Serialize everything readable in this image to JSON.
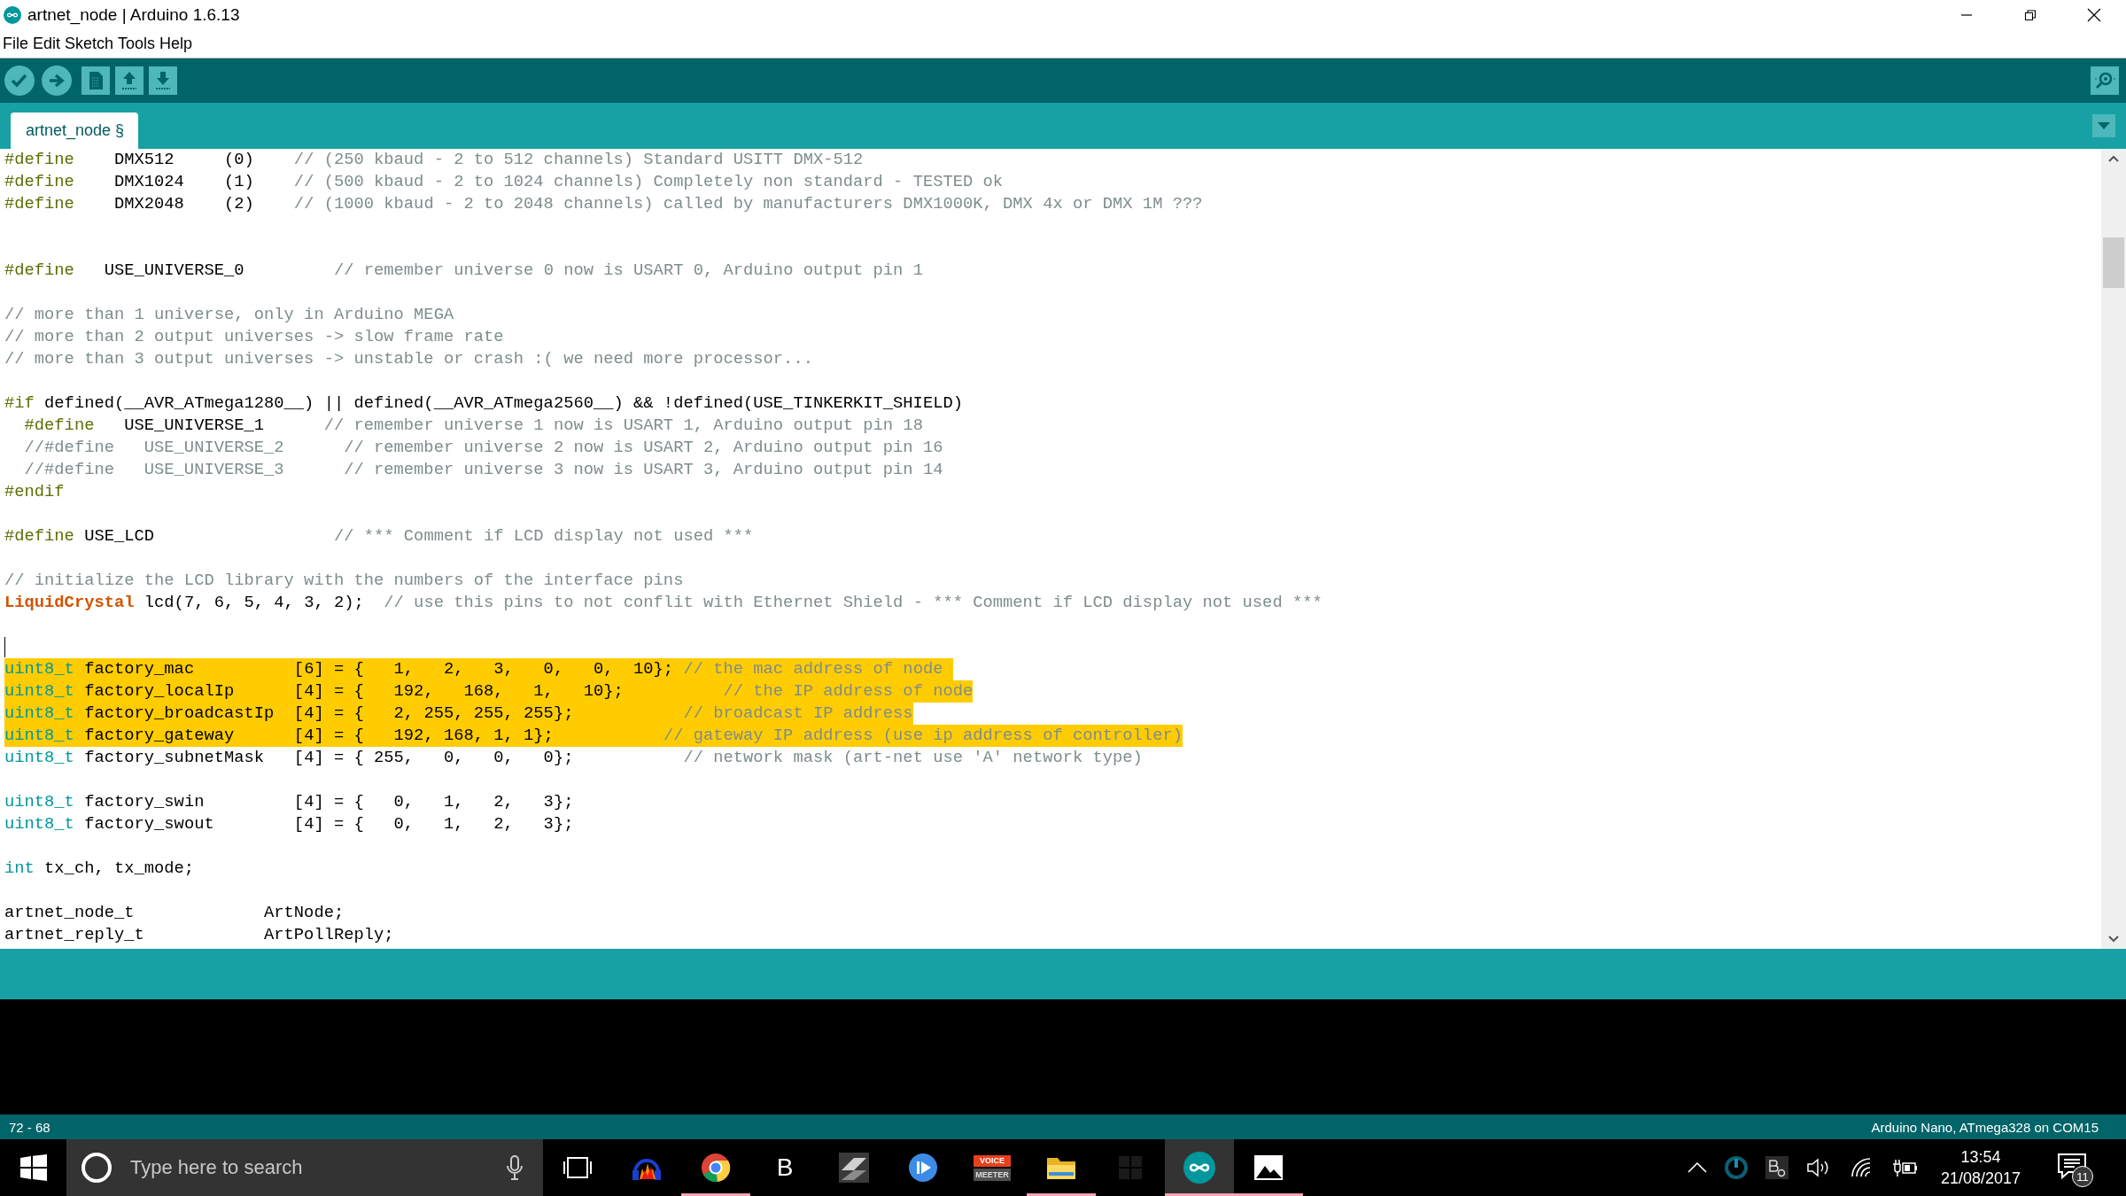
{
  "window": {
    "title": "artnet_node | Arduino 1.6.13"
  },
  "menu": [
    "File",
    "Edit",
    "Sketch",
    "Tools",
    "Help"
  ],
  "toolbar": [
    {
      "kind": "verify"
    },
    {
      "kind": "upload"
    },
    {
      "kind": "new"
    },
    {
      "kind": "open"
    },
    {
      "kind": "save"
    },
    {
      "kind": "serial-monitor"
    }
  ],
  "tabs": [
    {
      "label": "artnet_node §",
      "selected": true
    }
  ],
  "editor": {
    "lines": [
      {
        "highlighted": false,
        "caret": false,
        "segments": [
          {
            "kind": "directive",
            "text": "#define"
          },
          {
            "kind": "plain",
            "text": "    DMX512     (0)    "
          },
          {
            "kind": "comment",
            "text": "// (250 kbaud - 2 to 512 channels) Standard USITT DMX-512"
          }
        ]
      },
      {
        "highlighted": false,
        "caret": false,
        "segments": [
          {
            "kind": "directive",
            "text": "#define"
          },
          {
            "kind": "plain",
            "text": "    DMX1024    (1)    "
          },
          {
            "kind": "comment",
            "text": "// (500 kbaud - 2 to 1024 channels) Completely non standard - TESTED ok"
          }
        ]
      },
      {
        "highlighted": false,
        "caret": false,
        "segments": [
          {
            "kind": "directive",
            "text": "#define"
          },
          {
            "kind": "plain",
            "text": "    DMX2048    (2)    "
          },
          {
            "kind": "comment",
            "text": "// (1000 kbaud - 2 to 2048 channels) called by manufacturers DMX1000K, DMX 4x or DMX 1M ???"
          }
        ]
      },
      {
        "highlighted": false,
        "caret": false
      },
      {
        "highlighted": false,
        "caret": false
      },
      {
        "highlighted": false,
        "caret": false,
        "segments": [
          {
            "kind": "directive",
            "text": "#define"
          },
          {
            "kind": "plain",
            "text": "   USE_UNIVERSE_0         "
          },
          {
            "kind": "comment",
            "text": "// remember universe 0 now is USART 0, Arduino output pin 1"
          }
        ]
      },
      {
        "highlighted": false,
        "caret": false
      },
      {
        "highlighted": false,
        "caret": false,
        "segments": [
          {
            "kind": "comment",
            "text": "// more than 1 universe, only in Arduino MEGA"
          }
        ]
      },
      {
        "highlighted": false,
        "caret": false,
        "segments": [
          {
            "kind": "comment",
            "text": "// more than 2 output universes -> slow frame rate"
          }
        ]
      },
      {
        "highlighted": false,
        "caret": false,
        "segments": [
          {
            "kind": "comment",
            "text": "// more than 3 output universes -> unstable or crash :( we need more processor..."
          }
        ]
      },
      {
        "highlighted": false,
        "caret": false
      },
      {
        "highlighted": false,
        "caret": false,
        "segments": [
          {
            "kind": "directive",
            "text": "#if"
          },
          {
            "kind": "plain",
            "text": " defined(__AVR_ATmega1280__) || defined(__AVR_ATmega2560__) && !defined(USE_TINKERKIT_SHIELD)"
          }
        ]
      },
      {
        "highlighted": false,
        "caret": false,
        "segments": [
          {
            "kind": "directive",
            "text": "  #define"
          },
          {
            "kind": "plain",
            "text": "   USE_UNIVERSE_1      "
          },
          {
            "kind": "comment",
            "text": "// remember universe 1 now is USART 1, Arduino output pin 18"
          }
        ]
      },
      {
        "highlighted": false,
        "caret": false,
        "segments": [
          {
            "kind": "comment",
            "text": "  //#define   USE_UNIVERSE_2      // remember universe 2 now is USART 2, Arduino output pin 16"
          }
        ]
      },
      {
        "highlighted": false,
        "caret": false,
        "segments": [
          {
            "kind": "comment",
            "text": "  //#define   USE_UNIVERSE_3      // remember universe 3 now is USART 3, Arduino output pin 14"
          }
        ]
      },
      {
        "highlighted": false,
        "caret": false,
        "segments": [
          {
            "kind": "directive",
            "text": "#endif"
          }
        ]
      },
      {
        "highlighted": false,
        "caret": false
      },
      {
        "highlighted": false,
        "caret": false,
        "segments": [
          {
            "kind": "directive",
            "text": "#define"
          },
          {
            "kind": "plain",
            "text": " USE_LCD                  "
          },
          {
            "kind": "comment",
            "text": "// *** Comment if LCD display not used ***"
          }
        ]
      },
      {
        "highlighted": false,
        "caret": false
      },
      {
        "highlighted": false,
        "caret": false,
        "segments": [
          {
            "kind": "comment",
            "text": "// initialize the LCD library with the numbers of the interface pins"
          }
        ]
      },
      {
        "highlighted": false,
        "caret": false,
        "segments": [
          {
            "kind": "class",
            "text": "LiquidCrystal"
          },
          {
            "kind": "plain",
            "text": " lcd(7, 6, 5, 4, 3, 2);  "
          },
          {
            "kind": "comment",
            "text": "// use this pins to not conflit with Ethernet Shield - *** Comment if LCD display not used ***"
          }
        ]
      },
      {
        "highlighted": false,
        "caret": false
      },
      {
        "highlighted": false,
        "caret": true
      },
      {
        "highlighted": true,
        "caret": false,
        "segments": [
          {
            "kind": "type",
            "text": "uint8_t"
          },
          {
            "kind": "plain",
            "text": " factory_mac          [6] = {   1,   2,   3,   0,   0,  10}; "
          },
          {
            "kind": "comment",
            "text": "// the mac address of node "
          }
        ]
      },
      {
        "highlighted": true,
        "caret": false,
        "segments": [
          {
            "kind": "type",
            "text": "uint8_t"
          },
          {
            "kind": "plain",
            "text": " factory_localIp      [4] = {   192,   168,   1,   10};          "
          },
          {
            "kind": "comment",
            "text": "// the IP address of node"
          }
        ]
      },
      {
        "highlighted": true,
        "caret": false,
        "segments": [
          {
            "kind": "type",
            "text": "uint8_t"
          },
          {
            "kind": "plain",
            "text": " factory_broadcastIp  [4] = {   2, 255, 255, 255};           "
          },
          {
            "kind": "comment",
            "text": "// broadcast IP address"
          }
        ]
      },
      {
        "highlighted": true,
        "caret": false,
        "segments": [
          {
            "kind": "type",
            "text": "uint8_t"
          },
          {
            "kind": "plain",
            "text": " factory_gateway      [4] = {   192, 168, 1, 1};           "
          },
          {
            "kind": "comment",
            "text": "// gateway IP address (use ip address of controller)"
          }
        ]
      },
      {
        "highlighted": false,
        "caret": false,
        "segments": [
          {
            "kind": "type",
            "text": "uint8_t"
          },
          {
            "kind": "plain",
            "text": " factory_subnetMask   [4] = { 255,   0,   0,   0};           "
          },
          {
            "kind": "comment",
            "text": "// network mask (art-net use 'A' network type)"
          }
        ]
      },
      {
        "highlighted": false,
        "caret": false
      },
      {
        "highlighted": false,
        "caret": false,
        "segments": [
          {
            "kind": "type",
            "text": "uint8_t"
          },
          {
            "kind": "plain",
            "text": " factory_swin         [4] = {   0,   1,   2,   3};"
          }
        ]
      },
      {
        "highlighted": false,
        "caret": false,
        "segments": [
          {
            "kind": "type",
            "text": "uint8_t"
          },
          {
            "kind": "plain",
            "text": " factory_swout        [4] = {   0,   1,   2,   3};"
          }
        ]
      },
      {
        "highlighted": false,
        "caret": false
      },
      {
        "highlighted": false,
        "caret": false,
        "segments": [
          {
            "kind": "type",
            "text": "int"
          },
          {
            "kind": "plain",
            "text": " tx_ch, tx_mode;"
          }
        ]
      },
      {
        "highlighted": false,
        "caret": false
      },
      {
        "highlighted": false,
        "caret": false,
        "segments": [
          {
            "kind": "plain",
            "text": "artnet_node_t             ArtNode;"
          }
        ]
      },
      {
        "highlighted": false,
        "caret": false,
        "segments": [
          {
            "kind": "plain",
            "text": "artnet_reply_t            ArtPollReply;"
          }
        ]
      }
    ]
  },
  "status_bar": {
    "position": "72 - 68",
    "board": "Arduino Nano, ATmega328 on COM15"
  },
  "taskbar": {
    "search": {
      "placeholder": "Type here to search"
    },
    "apps": [
      {
        "kind": "task-view",
        "running": false,
        "selected": false
      },
      {
        "kind": "audio",
        "running": false,
        "selected": false
      },
      {
        "kind": "browser",
        "running": true,
        "selected": false
      },
      {
        "kind": "letter",
        "label": "B",
        "running": false,
        "selected": false
      },
      {
        "kind": "gray-app",
        "running": false,
        "selected": false
      },
      {
        "kind": "player",
        "running": false,
        "selected": false
      },
      {
        "kind": "mixer",
        "label": "VOICE",
        "sublabel": "MEETER",
        "running": false,
        "selected": false
      },
      {
        "kind": "folder",
        "running": true,
        "selected": false
      },
      {
        "kind": "dim-app",
        "running": false,
        "selected": false
      },
      {
        "kind": "arduino",
        "running": true,
        "selected": true
      },
      {
        "kind": "photos",
        "running": true,
        "selected": false
      }
    ],
    "tray": {
      "time": "13:54",
      "date": "21/08/2017",
      "notifications": "11"
    }
  }
}
